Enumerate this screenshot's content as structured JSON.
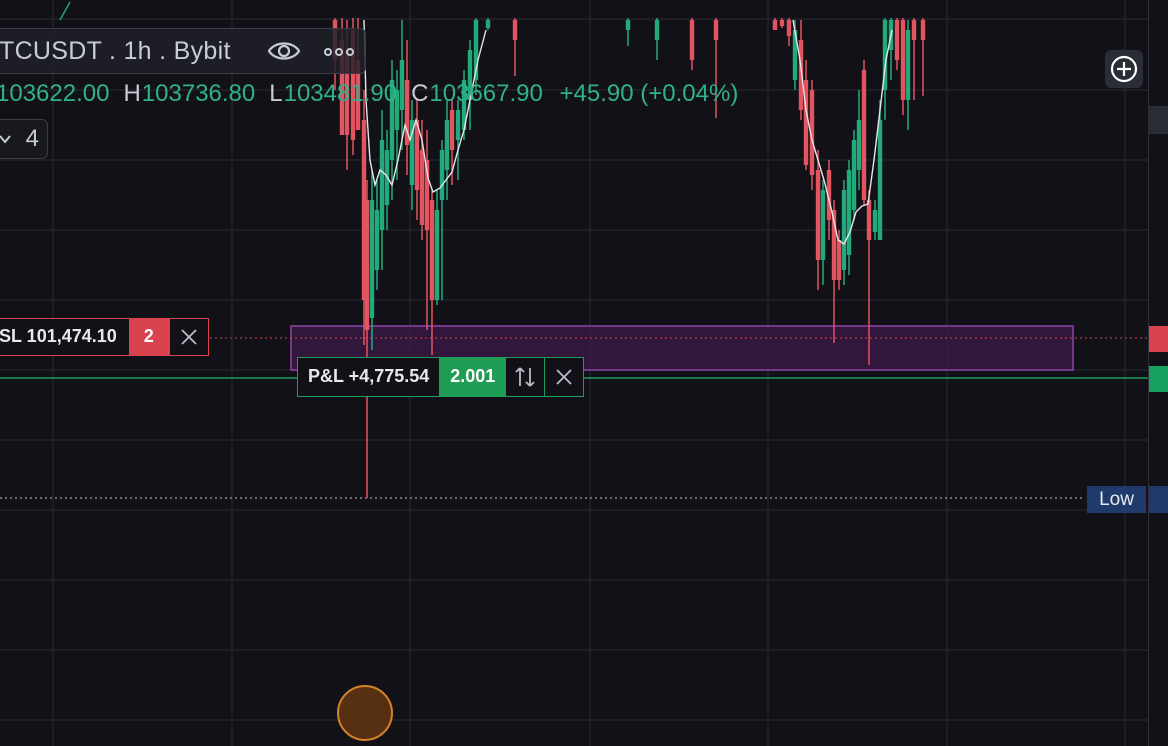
{
  "symbol_bar": {
    "text": "TCUSDT . 1h . Bybit",
    "eye_icon": "eye-icon",
    "more_icon": "more-icon"
  },
  "ohlc": {
    "o_value": "103622.00",
    "h_label": "H",
    "h_value": "103736.80",
    "l_label": "L",
    "l_value": "103481.90",
    "c_label": "C",
    "c_value": "103667.90",
    "change": "+45.90 (+0.04%)"
  },
  "indicator_badge": {
    "count": "4",
    "icon": "chevron-down-icon"
  },
  "stop_loss": {
    "label": "SL 101,474.10",
    "qty": "2",
    "close_icon": "close-icon"
  },
  "position": {
    "label": "P&L +4,775.54",
    "qty": "2.001",
    "reverse_icon": "reverse-arrows-icon",
    "close_icon": "close-icon"
  },
  "price_axis": {
    "low_label": "Low"
  },
  "colors": {
    "background": "#131118",
    "up": "#22ab7a",
    "down": "#e2545f",
    "sl_red": "#d9434f",
    "pnl_green": "#1f9d55",
    "zone": "#4a1f55",
    "low_label_bg": "#1f3a6b"
  }
}
